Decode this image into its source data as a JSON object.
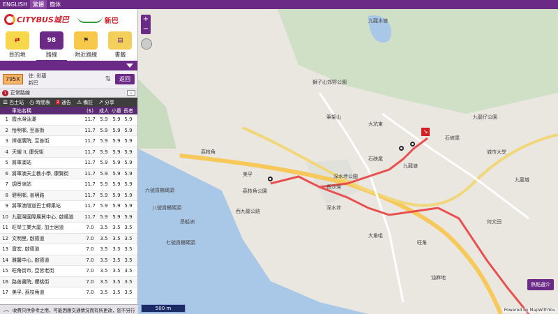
{
  "lang": [
    "ENGLISH",
    "繁體",
    "簡体"
  ],
  "logos": {
    "citybus": "CITYBUS城巴",
    "nwfb": "新巴"
  },
  "nav": [
    {
      "label": "目的地",
      "icon": "destination-icon"
    },
    {
      "label": "路線",
      "icon": "route-icon",
      "badge": "98"
    },
    {
      "label": "附近路線",
      "icon": "nearby-icon"
    },
    {
      "label": "書籤",
      "icon": "bookmark-icon"
    }
  ],
  "route": {
    "number": "795X",
    "from_label": "往: 彩蘊",
    "operator": "新巴",
    "back": "返回"
  },
  "direction": {
    "index": "1",
    "label": "正常路線"
  },
  "tools": {
    "stops": "巴士站",
    "timetable": "時間表",
    "notice": "通告",
    "notice_count": "2",
    "remarks": "備註",
    "share": "分享"
  },
  "table": {
    "headers": [
      "車站名稱",
      "($)",
      "成人",
      "小童",
      "長者"
    ],
    "rows": [
      {
        "no": "1",
        "name": "霞水灣泳灘",
        "p1": "11.7",
        "p2": "5.9",
        "p3": "5.9"
      },
      {
        "no": "2",
        "name": "怡明邨, 至善街",
        "p1": "11.7",
        "p2": "5.9",
        "p3": "5.9"
      },
      {
        "no": "3",
        "name": "擇運廣院, 至善街",
        "p1": "11.7",
        "p2": "5.9",
        "p3": "5.9"
      },
      {
        "no": "4",
        "name": "天耀 II, 康倪街",
        "p1": "11.7",
        "p2": "5.9",
        "p3": "5.9"
      },
      {
        "no": "5",
        "name": "將軍澳站",
        "p1": "11.7",
        "p2": "5.9",
        "p3": "5.9"
      },
      {
        "no": "6",
        "name": "將軍澳天主教小學, 康賢街",
        "p1": "11.7",
        "p2": "5.9",
        "p3": "5.9"
      },
      {
        "no": "7",
        "name": "調景嶺站",
        "p1": "11.7",
        "p2": "5.9",
        "p3": "5.9"
      },
      {
        "no": "8",
        "name": "健明邨, 善明路",
        "p1": "11.7",
        "p2": "5.9",
        "p3": "5.9"
      },
      {
        "no": "9",
        "name": "將軍澳隧道巴士轉乘站",
        "p1": "11.7",
        "p2": "5.9",
        "p3": "5.9"
      },
      {
        "no": "10",
        "name": "九龍灣國際展貿中心, 啟禧道",
        "p1": "11.7",
        "p2": "5.9",
        "p3": "5.9"
      },
      {
        "no": "11",
        "name": "旺琴工業大廈, 加士居道",
        "p1": "7.0",
        "p2": "3.5",
        "p3": "3.5"
      },
      {
        "no": "12",
        "name": "文明里, 啟德道",
        "p1": "7.0",
        "p2": "3.5",
        "p3": "3.5"
      },
      {
        "no": "13",
        "name": "寶宏, 啟德道",
        "p1": "7.0",
        "p2": "3.5",
        "p3": "3.5"
      },
      {
        "no": "14",
        "name": "雅馨中心, 啟德道",
        "p1": "7.0",
        "p2": "3.5",
        "p3": "3.5"
      },
      {
        "no": "15",
        "name": "旺角街市, 亞皆老街",
        "p1": "7.0",
        "p2": "3.5",
        "p3": "3.5"
      },
      {
        "no": "16",
        "name": "路善書院, 櫻桃街",
        "p1": "7.0",
        "p2": "3.5",
        "p3": "3.5"
      },
      {
        "no": "17",
        "name": "美孚, 荔枝角道",
        "p1": "7.0",
        "p2": "3.5",
        "p3": "3.5"
      }
    ]
  },
  "footer": "收費只供參考之用，可能因應交通情況而有所更改，恕不另行",
  "map": {
    "zoom_in": "+",
    "zoom_out": "−",
    "scale": "500 m",
    "legend_btn": "顯示/隱藏圖例",
    "legend_short": "熱點選介",
    "attribution": "Powered by MapWithYou",
    "labels": [
      "九龍水塘",
      "美孚",
      "荔枝角公園",
      "長沙灣",
      "深水埗",
      "旺角",
      "九龍塘",
      "大角咀",
      "獅子山郊野公園",
      "石硤尾",
      "油麻地",
      "何文田",
      "九龍城",
      "六號貨櫃碼頭",
      "昂船洲",
      "西九龍公路",
      "深水埗公園",
      "荔枝角",
      "城市大學",
      "石峽尾",
      "大坑東",
      "九龍仔公園",
      "筆架山",
      "七號貨櫃碼頭",
      "八號貨櫃碼頭"
    ]
  }
}
